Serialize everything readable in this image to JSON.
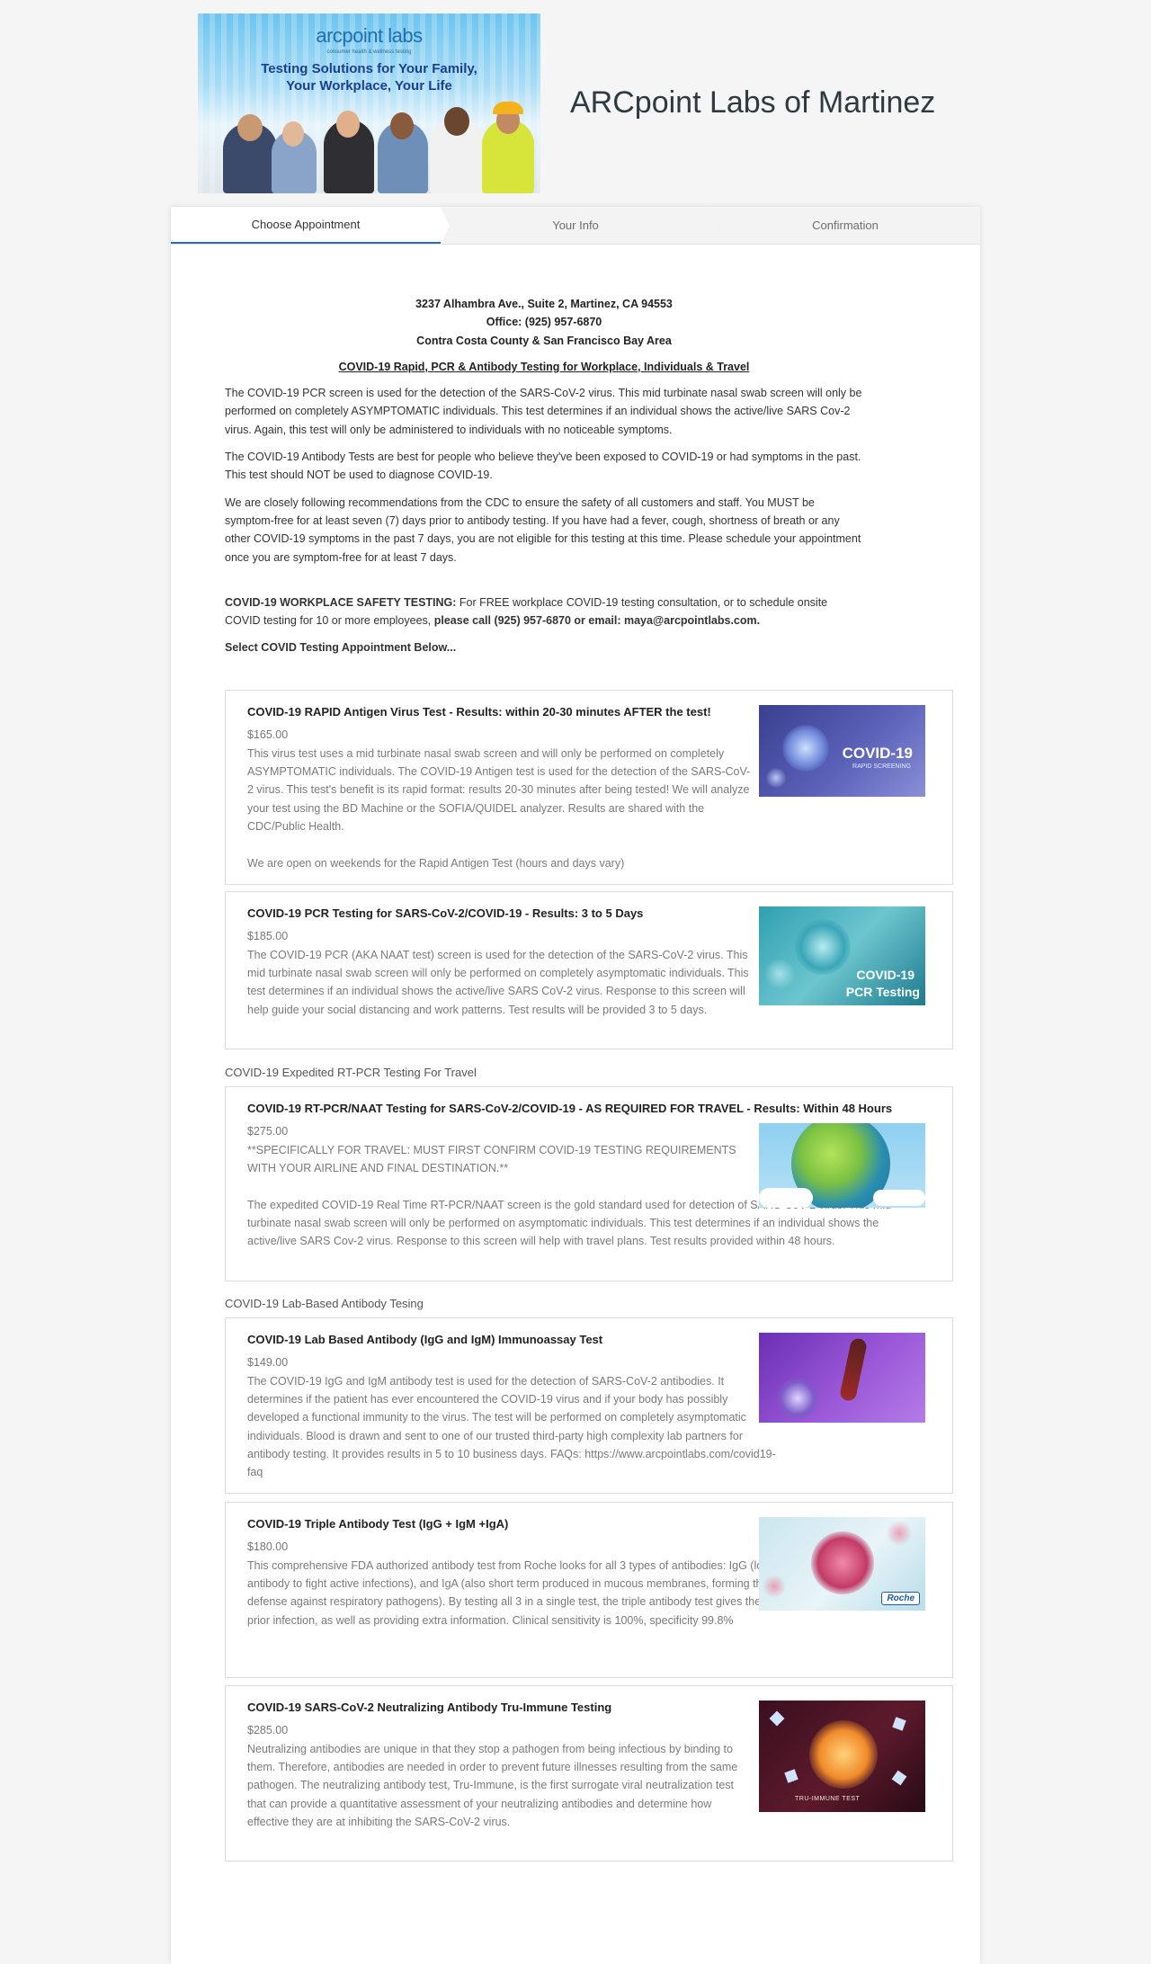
{
  "header": {
    "banner": {
      "brand": "arcpoint labs",
      "brand_sub": "consumer health & wellness testing",
      "tagline_1": "Testing Solutions for Your Family,",
      "tagline_2": "Your Workplace, Your Life"
    },
    "site_title": "ARCpoint Labs of Martinez"
  },
  "steps": [
    "Choose Appointment",
    "Your Info",
    "Confirmation"
  ],
  "intro": {
    "address": "3237 Alhambra Ave., Suite 2, Martinez, CA 94553",
    "office": "Office: (925) 957-6870",
    "area": "Contra Costa County & San Francisco Bay Area",
    "headline": "COVID-19 Rapid, PCR & Antibody Testing for Workplace, Individuals & Travel",
    "p1": "The COVID-19 PCR screen is used for the detection of the SARS-CoV-2 virus. This mid turbinate nasal swab screen will only be performed on completely ASYMPTOMATIC individuals. This test determines if an individual shows the active/live SARS Cov-2 virus. Again, this test will only be administered to individuals with no noticeable symptoms.",
    "p2": "The COVID-19 Antibody Tests are best for people who believe they've been exposed to COVID-19 or had symptoms in the past. This test should NOT be used to diagnose COVID-19.",
    "p3": "We are closely following recommendations from the CDC to ensure the safety of all customers and staff. You MUST be symptom-free for at least seven (7) days prior to antibody testing. If you have had a fever, cough, shortness of breath or any other COVID-19 symptoms in the past 7 days, you are not eligible for this testing at this time. Please schedule your appointment once you are symptom-free for at least 7 days.",
    "workplace_label": "COVID-19 WORKPLACE SAFETY TESTING:",
    "workplace_text": " For FREE workplace COVID-19 testing consultation, or to schedule onsite COVID testing for 10 or more employees, ",
    "workplace_contact": "please call (925) 957-6870 or email: maya@arcpointlabs.com.",
    "select_prompt": "Select COVID Testing Appointment Below..."
  },
  "sections": {
    "travel": "COVID-19 Expedited RT-PCR Testing For Travel",
    "antibody": "COVID-19 Lab-Based Antibody Tesing"
  },
  "services": [
    {
      "title": "COVID-19 RAPID Antigen Virus Test - Results: within 20-30 minutes AFTER the test!",
      "price": "$165.00",
      "description": "This virus test uses a mid turbinate nasal swab screen and will only be performed on completely ASYMPTOMATIC individuals. The COVID-19 Antigen test is used for the detection of the SARS-CoV-2 virus. This test's benefit is its rapid format: results 20-30 minutes after being tested! We will analyze your test using the BD Machine or the SOFIA/QUIDEL analyzer. Results are shared with the CDC/Public Health.",
      "note": "We are open on weekends for the Rapid Antigen Test (hours and days vary)",
      "thumb_text_1": "COVID-19",
      "thumb_text_2": "RAPID SCREENING"
    },
    {
      "title": "COVID-19 PCR Testing for SARS-CoV-2/COVID-19 - Results: 3 to 5 Days",
      "price": "$185.00",
      "description": "The COVID-19 PCR (AKA NAAT test) screen is used for the detection of the SARS-CoV-2 virus. This mid turbinate nasal swab screen will only be performed on completely asymptomatic individuals. This test determines if an individual shows the active/live SARS CoV-2 virus. Response to this screen will help guide your social distancing and work patterns. Test results will be provided 3 to 5 days.",
      "thumb_text_1": "COVID-19",
      "thumb_text_2": "PCR Testing"
    },
    {
      "title": "COVID-19 RT-PCR/NAAT Testing for SARS-CoV-2/COVID-19 - AS REQUIRED FOR TRAVEL - Results: Within 48 Hours",
      "price": "$275.00",
      "notice": "**SPECIFICALLY FOR TRAVEL: MUST FIRST CONFIRM COVID-19 TESTING REQUIREMENTS WITH YOUR AIRLINE AND FINAL DESTINATION.**",
      "description": "The expedited COVID-19 Real Time RT-PCR/NAAT screen is the gold standard used for detection of SARS-CoV-2 virus. This mid turbinate nasal swab screen will only be performed on asymptomatic individuals. This test determines if an individual shows the active/live SARS Cov-2 virus. Response to this screen will help with travel plans. Test results provided within 48 hours."
    },
    {
      "title": "COVID-19 Lab Based Antibody (IgG and IgM) Immunoassay Test",
      "price": "$149.00",
      "description": "The COVID-19 IgG and IgM antibody test is used for the detection of SARS-CoV-2 antibodies. It determines if the patient has ever encountered the COVID-19 virus and if your body has possibly developed a functional immunity to the virus. The test will be performed on completely asymptomatic individuals. Blood is drawn and sent to one of our trusted third-party high complexity lab partners for antibody testing. It provides results in 5 to 10 business days. FAQs: https://www.arcpointlabs.com/covid19-faq"
    },
    {
      "title": "COVID-19 Triple Antibody Test (IgG + IgM +IgA)",
      "price": "$180.00",
      "description": "This comprehensive FDA authorized antibody test from Roche looks for all 3 types of antibodies: IgG (long term) , IgM (short term antibody to fight active infections), and IgA (also short term produced in mucous membranes, forming the body's first line of active defense against respiratory pathogens). By testing all 3 in a single test, the triple antibody test gives the greatest chance of detecting a prior infection, as well as providing extra information. Clinical sensitivity is 100%, specificity 99.8%",
      "thumb_text_1": "Roche"
    },
    {
      "title": "COVID-19 SARS-CoV-2 Neutralizing Antibody Tru-Immune Testing",
      "price": "$285.00",
      "description": "Neutralizing antibodies are unique in that they stop a pathogen from being infectious by binding to them. Therefore, antibodies are needed in order to prevent future illnesses resulting from the same pathogen. The neutralizing antibody test, Tru-Immune, is the first surrogate viral neutralization test that can provide a quantitative assessment of your neutralizing antibodies and determine how effective they are at inhibiting the SARS-CoV-2 virus.",
      "thumb_text_1": "TRU-IMMUNE TEST"
    }
  ]
}
